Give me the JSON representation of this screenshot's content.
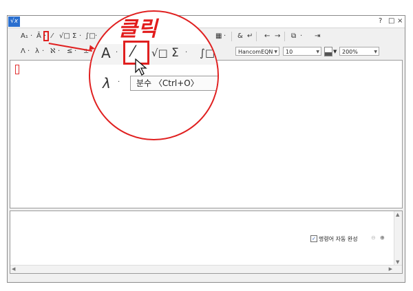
{
  "titlebar": {
    "app_icon": "√x",
    "help": "?",
    "restore": "□",
    "close": "×"
  },
  "toolbar1": {
    "items": [
      "A₁",
      "·",
      "Ā",
      "·",
      "⁄",
      "√□",
      "Σ",
      "·",
      "∫□",
      "·"
    ],
    "right_items": [
      "▦",
      "·",
      "&",
      "↵",
      "←",
      "→",
      "⧉",
      "·",
      "⇥"
    ]
  },
  "toolbar2": {
    "items": [
      "Λ",
      "·",
      "λ",
      "·",
      "ℵ",
      "·",
      "≤",
      "·",
      "±"
    ],
    "font_combo": "HancomEQN",
    "size_combo": "10",
    "color_swatch": "color-swatch",
    "zoom_combo": "200%"
  },
  "magnifier": {
    "row1": [
      "A",
      "·",
      "⁄",
      "√□",
      "Σ",
      "·",
      "∫□",
      "⇥"
    ],
    "row2": [
      "λ",
      "·"
    ],
    "tooltip": "분수 〈Ctrl+O〉"
  },
  "callout": "클릭",
  "bottom": {
    "autocomplete_label": "명령어 자동 완성",
    "autocomplete_checked": "✓",
    "zoom_out": "🔍",
    "zoom_in": "🔍"
  },
  "colors": {
    "highlight": "#e02020",
    "accent": "#2a6fcf"
  }
}
